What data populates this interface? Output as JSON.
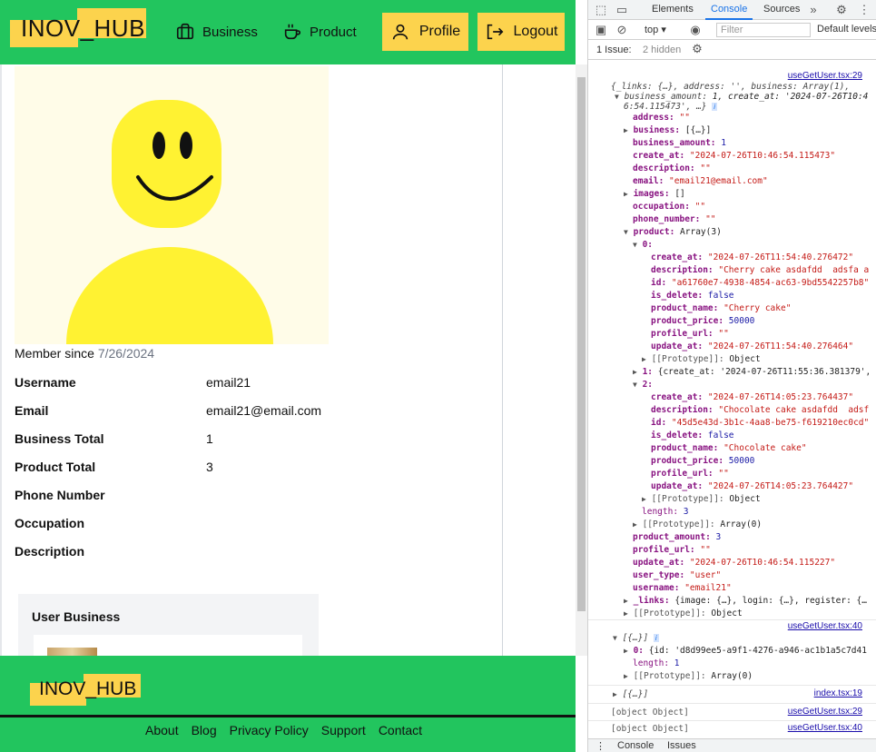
{
  "nav": {
    "logo": "INOV_HUB",
    "business": "Business",
    "product": "Product",
    "profile": "Profile",
    "logout": "Logout"
  },
  "profile": {
    "member_since_label": "Member since",
    "member_since_date": "7/26/2024",
    "fields": [
      {
        "label": "Username",
        "value": "email21"
      },
      {
        "label": "Email",
        "value": "email21@email.com"
      },
      {
        "label": "Business Total",
        "value": "1"
      },
      {
        "label": "Product Total",
        "value": "3"
      },
      {
        "label": "Phone Number",
        "value": ""
      },
      {
        "label": "Occupation",
        "value": ""
      },
      {
        "label": "Description",
        "value": ""
      }
    ],
    "user_business_title": "User Business"
  },
  "footer": {
    "logo": "INOV_HUB",
    "links": [
      "About",
      "Blog",
      "Privacy Policy",
      "Support",
      "Contact"
    ]
  },
  "devtools": {
    "tabs": [
      "Elements",
      "Console",
      "Sources"
    ],
    "context": "top",
    "filter_placeholder": "Filter",
    "levels": "Default levels",
    "issues_label": "1 Issue:",
    "hidden_label": "2 hidden",
    "bottom_tabs": [
      "Console",
      "Issues"
    ],
    "logs": [
      {
        "src": "useGetUser.tsx:29"
      },
      {
        "src": "useGetUser.tsx:40"
      },
      {
        "src": "index.tsx:19"
      },
      {
        "src": "useGetUser.tsx:29",
        "text": "[object Object]"
      },
      {
        "src": "useGetUser.tsx:40",
        "text": "[object Object]"
      }
    ],
    "lines": [
      "{_links: {…}, address: '', business: Array(1),",
      "business_amount: 1, create_at: '2024-07-26T10:4",
      "6:54.115473', …}",
      "address: \"\"",
      "business: [{…}]",
      "business_amount: 1",
      "create_at: \"2024-07-26T10:46:54.115473\"",
      "description: \"\"",
      "email: \"email21@email.com\"",
      "images: []",
      "occupation: \"\"",
      "phone_number: \"\"",
      "product: Array(3)",
      "0:",
      "create_at: \"2024-07-26T11:54:40.276472\"",
      "description: \"Cherry cake asdafdd  adsfa a",
      "id: \"a61760e7-4938-4854-ac63-9bd5542257b8\"",
      "is_delete: false",
      "product_name: \"Cherry cake\"",
      "product_price: 50000",
      "profile_url: \"\"",
      "update_at: \"2024-07-26T11:54:40.276464\"",
      "[[Prototype]]: Object",
      "1: {create_at: '2024-07-26T11:55:36.381379',",
      "2:",
      "create_at: \"2024-07-26T14:05:23.764437\"",
      "description: \"Chocolate cake asdafdd  adsf",
      "id: \"45d5e43d-3b1c-4aa8-be75-f619210ec0cd\"",
      "is_delete: false",
      "product_name: \"Chocolate cake\"",
      "product_price: 50000",
      "profile_url: \"\"",
      "update_at: \"2024-07-26T14:05:23.764427\"",
      "[[Prototype]]: Object",
      "length: 3",
      "[[Prototype]]: Array(0)",
      "product_amount: 3",
      "profile_url: \"\"",
      "update_at: \"2024-07-26T10:46:54.115227\"",
      "user_type: \"user\"",
      "username: \"email21\"",
      "_links: {image: {…}, login: {…}, register: {…",
      "[[Prototype]]: Object",
      "[{…}]",
      "0: {id: 'd8d99ee5-a9f1-4276-a946-ac1b1a5c7d41",
      "length: 1",
      "[[Prototype]]: Array(0)",
      "[{…}]"
    ]
  }
}
